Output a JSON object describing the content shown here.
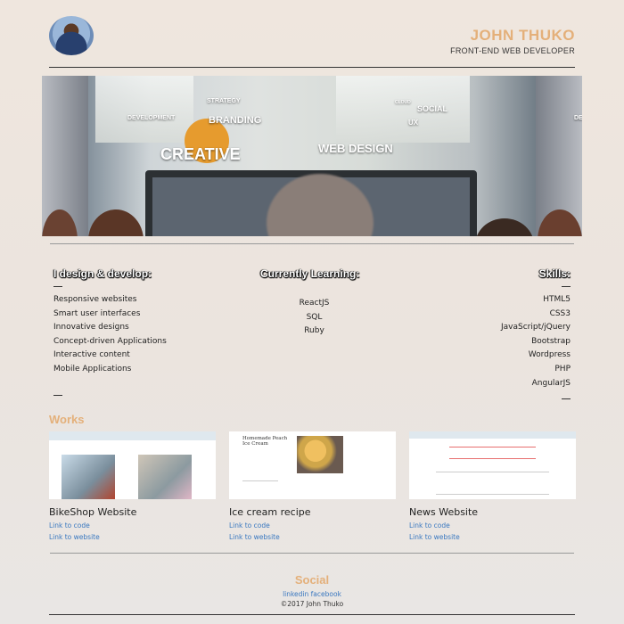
{
  "header": {
    "name": "JOHN THUKO",
    "role": "FRONT-END WEB DEVELOPER",
    "accent_color": "#e4b07a"
  },
  "banner": {
    "tags": [
      "DEVELOPMENT",
      "STRATEGY",
      "BRANDING",
      "CREATIVE",
      "WEB DESIGN",
      "SOCIAL",
      "CLOUD",
      "UX",
      "DE"
    ]
  },
  "design": {
    "heading": "I design & develop:",
    "items": [
      "Responsive websites",
      "Smart user interfaces",
      "Innovative designs",
      "Concept-driven Applications",
      "Interactive content",
      "Mobile Applications"
    ]
  },
  "learning": {
    "heading": "Currently Learning:",
    "items": [
      "ReactJS",
      "SQL",
      "Ruby"
    ]
  },
  "skills": {
    "heading": "Skills:",
    "items": [
      "HTML5",
      "CSS3",
      "JavaScript/jQuery",
      "Bootstrap",
      "Wordpress",
      "PHP",
      "AngularJS"
    ]
  },
  "works": {
    "heading": "Works",
    "cards": [
      {
        "title": "BikeShop Website",
        "code": "Link to code",
        "site": "Link to website"
      },
      {
        "title": "Ice cream recipe",
        "code": "Link to code",
        "site": "Link to website",
        "thumb_title": "Homemade Peach Ice Cream"
      },
      {
        "title": "News Website",
        "code": "Link to code",
        "site": "Link to website"
      }
    ]
  },
  "social": {
    "heading": "Social",
    "links": "linkedin facebook",
    "copyright": "©2017 John Thuko",
    "link_color": "#3a78c0"
  }
}
